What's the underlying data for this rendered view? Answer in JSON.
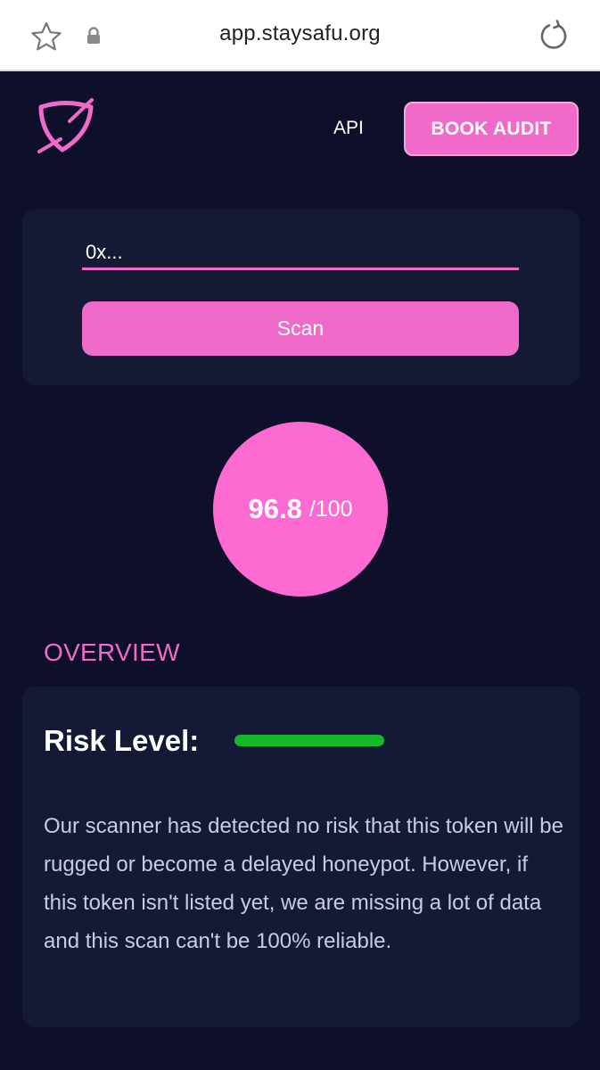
{
  "browser": {
    "url": "app.staysafu.org"
  },
  "header": {
    "nav_api": "API",
    "book_audit": "BOOK AUDIT"
  },
  "scan": {
    "placeholder": "0x...",
    "button_label": "Scan"
  },
  "score": {
    "value": "96.8",
    "max": "/100"
  },
  "overview": {
    "title": "OVERVIEW",
    "risk_label": "Risk Level:",
    "risk_level_fraction": 1.0,
    "risk_color": "#14b82a",
    "description": "Our scanner has detected no risk that this token will be rugged or become a delayed honeypot. However, if this token isn't listed yet, we are missing a lot of data and this scan can't be 100% reliable."
  },
  "colors": {
    "accent": "#f06bc9",
    "background": "#0d0f2b",
    "card": "#141a36"
  },
  "icons": {
    "bookmark": "star-icon",
    "secure": "lock-icon",
    "reload": "reload-icon",
    "brand": "shield-logo-icon"
  }
}
